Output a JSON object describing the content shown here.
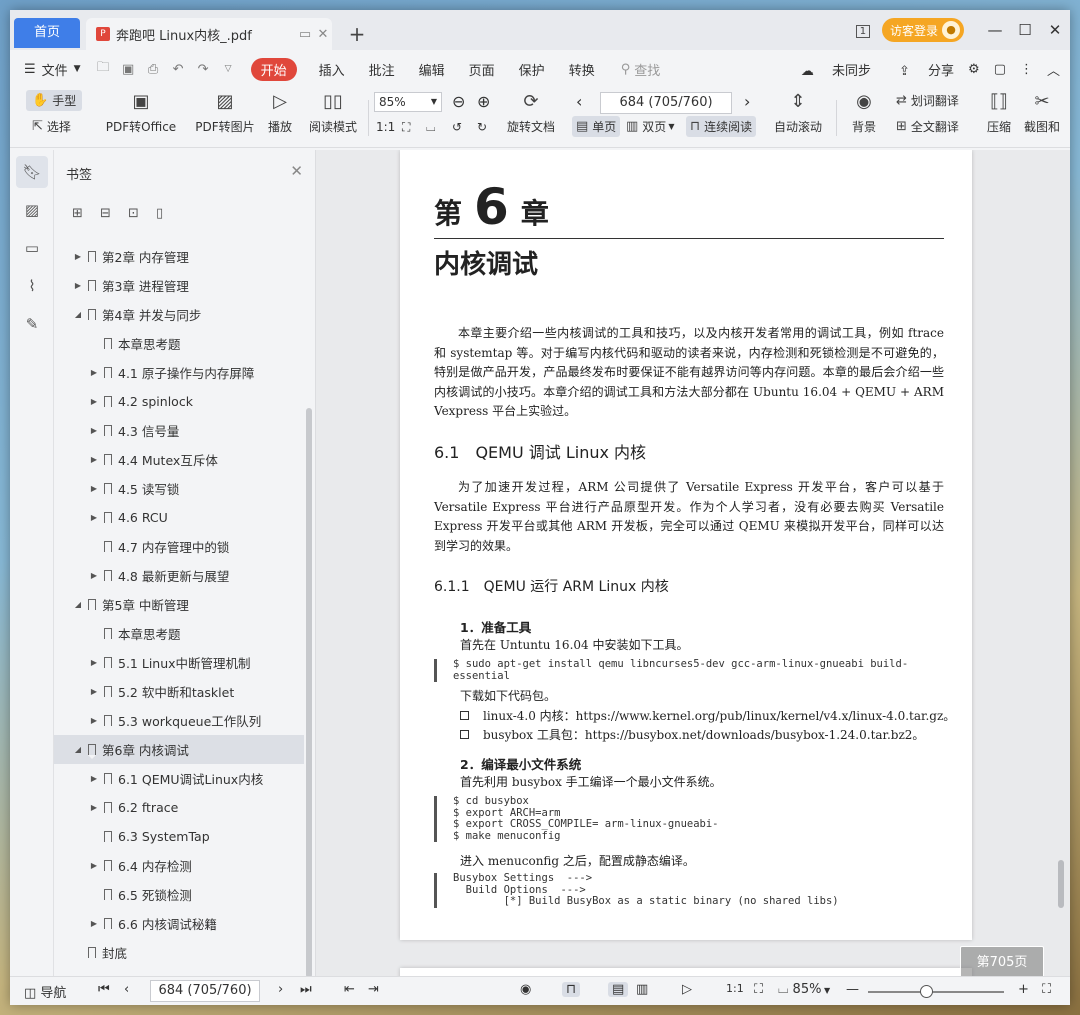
{
  "titlebar": {
    "home_tab": "首页",
    "doc_tab": "奔跑吧 Linux内核_.pdf",
    "pdf_icon": "P",
    "new_tab": "+",
    "screen_badge": "1",
    "login": "访客登录"
  },
  "menubar": {
    "file": "文件",
    "start": "开始",
    "items": [
      "插入",
      "批注",
      "编辑",
      "页面",
      "保护",
      "转换"
    ],
    "search": "查找",
    "sync": "未同步",
    "share": "分享"
  },
  "ribbon": {
    "hand": "手型",
    "select": "选择",
    "pdf_to_office": "PDF转Office",
    "pdf_to_image": "PDF转图片",
    "play": "播放",
    "read_mode": "阅读模式",
    "zoom": "85%",
    "rotate": "旋转文档",
    "page": "684 (705/760)",
    "single": "单页",
    "double": "双页",
    "continuous": "连续阅读",
    "auto_scroll": "自动滚动",
    "background": "背景",
    "word_translate": "划词翻译",
    "full_translate": "全文翻译",
    "compress": "压缩",
    "screenshot": "截图和"
  },
  "bookmarks": {
    "title": "书签",
    "items": [
      {
        "label": "第2章 内存管理",
        "level": 1,
        "arrow": "▶"
      },
      {
        "label": "第3章 进程管理",
        "level": 1,
        "arrow": "▶"
      },
      {
        "label": "第4章 并发与同步",
        "level": 1,
        "arrow": "◢"
      },
      {
        "label": "本章思考题",
        "level": 2,
        "arrow": ""
      },
      {
        "label": "4.1 原子操作与内存屏障",
        "level": 2,
        "arrow": "▶"
      },
      {
        "label": "4.2 spinlock",
        "level": 2,
        "arrow": "▶"
      },
      {
        "label": "4.3 信号量",
        "level": 2,
        "arrow": "▶"
      },
      {
        "label": "4.4 Mutex互斥体",
        "level": 2,
        "arrow": "▶"
      },
      {
        "label": "4.5 读写锁",
        "level": 2,
        "arrow": "▶"
      },
      {
        "label": "4.6 RCU",
        "level": 2,
        "arrow": "▶"
      },
      {
        "label": "4.7 内存管理中的锁",
        "level": 2,
        "arrow": ""
      },
      {
        "label": "4.8 最新更新与展望",
        "level": 2,
        "arrow": "▶"
      },
      {
        "label": "第5章 中断管理",
        "level": 1,
        "arrow": "◢"
      },
      {
        "label": "本章思考题",
        "level": 2,
        "arrow": ""
      },
      {
        "label": "5.1 Linux中断管理机制",
        "level": 2,
        "arrow": "▶"
      },
      {
        "label": "5.2 软中断和tasklet",
        "level": 2,
        "arrow": "▶"
      },
      {
        "label": "5.3 workqueue工作队列",
        "level": 2,
        "arrow": "▶"
      },
      {
        "label": "第6章 内核调试",
        "level": 1,
        "arrow": "◢"
      },
      {
        "label": "6.1 QEMU调试Linux内核",
        "level": 2,
        "arrow": "▶"
      },
      {
        "label": "6.2 ftrace",
        "level": 2,
        "arrow": "▶"
      },
      {
        "label": "6.3 SystemTap",
        "level": 2,
        "arrow": ""
      },
      {
        "label": "6.4 内存检测",
        "level": 2,
        "arrow": "▶"
      },
      {
        "label": "6.5 死锁检测",
        "level": 2,
        "arrow": ""
      },
      {
        "label": "6.6 内核调试秘籍",
        "level": 2,
        "arrow": "▶"
      },
      {
        "label": "封底",
        "level": 1,
        "arrow": ""
      }
    ],
    "active_index": 17
  },
  "doc": {
    "chap_prefix": "第",
    "chap_num": "6",
    "chap_suffix": "章",
    "chap_title": "内核调试",
    "intro": "本章主要介绍一些内核调试的工具和技巧，以及内核开发者常用的调试工具，例如 ftrace 和 systemtap 等。对于编写内核代码和驱动的读者来说，内存检测和死锁检测是不可避免的，特别是做产品开发，产品最终发布时要保证不能有越界访问等内存问题。本章的最后会介绍一些内核调试的小技巧。本章介绍的调试工具和方法大部分都在 Ubuntu 16.04 + QEMU + ARM Vexpress 平台上实验过。",
    "s61": "6.1　QEMU 调试 Linux 内核",
    "s61_para": "为了加速开发过程，ARM 公司提供了 Versatile Express 开发平台，客户可以基于 Versatile Express 平台进行产品原型开发。作为个人学习者，没有必要去购买 Versatile Express 开发平台或其他 ARM 开发板，完全可以通过 QEMU 来模拟开发平台，同样可以达到学习的效果。",
    "s611": "6.1.1　QEMU 运行 ARM Linux 内核",
    "step1": "1．准备工具",
    "step1_text": "首先在 Untuntu 16.04 中安装如下工具。",
    "code1": "$ sudo apt-get install qemu libncurses5-dev gcc-arm-linux-gnueabi build-\nessential",
    "download": "下载如下代码包。",
    "pkg1": "linux-4.0 内核：https://www.kernel.org/pub/linux/kernel/v4.x/linux-4.0.tar.gz。",
    "pkg2": "busybox 工具包：https://busybox.net/downloads/busybox-1.24.0.tar.bz2。",
    "step2": "2．编译最小文件系统",
    "step2_text": "首先利用 busybox 手工编译一个最小文件系统。",
    "code2": "$ cd busybox\n$ export ARCH=arm\n$ export CROSS_COMPILE= arm-linux-gnueabi-\n$ make menuconfig",
    "menu_text": "进入 menuconfig 之后，配置成静态编译。",
    "code3": "Busybox Settings  --->\n  Build Options  --->\n        [*] Build BusyBox as a static binary (no shared libs)",
    "page_tag": "第705页"
  },
  "status": {
    "nav": "导航",
    "page": "684 (705/760)",
    "zoom": "85%",
    "zoom_level_percent": 43
  }
}
